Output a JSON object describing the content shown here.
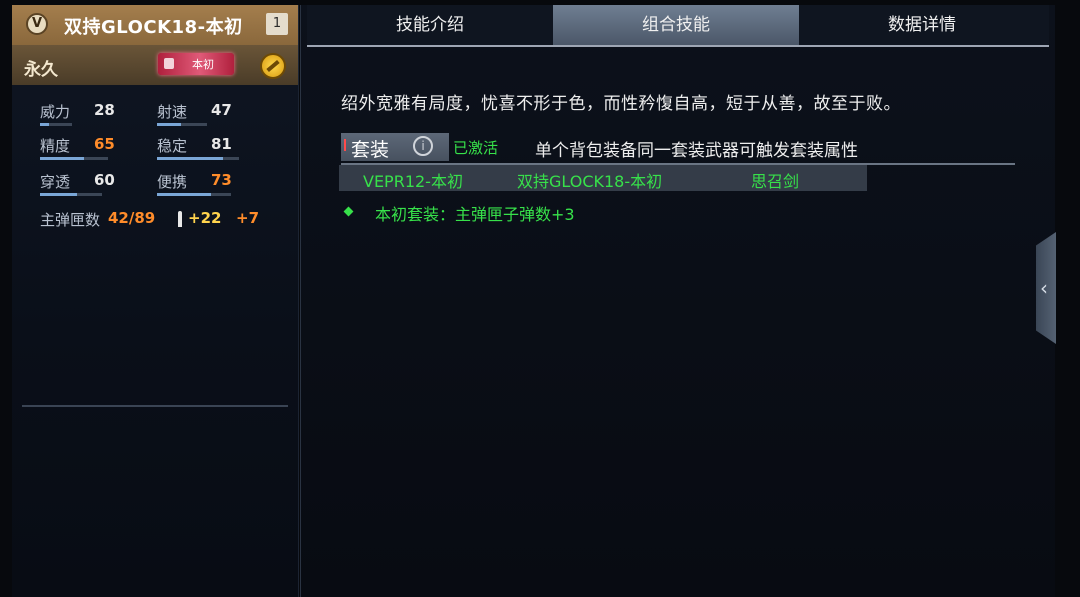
{
  "weapon": {
    "rank_badge": "V",
    "name": "双持GLOCK18-本初",
    "slot": "1",
    "duration": "永久",
    "skin_tag": "本初"
  },
  "stats": {
    "power": {
      "label": "威力",
      "value": "28",
      "level": 0.28
    },
    "fire_rate": {
      "label": "射速",
      "value": "47",
      "level": 0.47
    },
    "accuracy": {
      "label": "精度",
      "value": "65",
      "level": 0.65
    },
    "stability": {
      "label": "稳定",
      "value": "81",
      "level": 0.81
    },
    "penetration": {
      "label": "穿透",
      "value": "60",
      "level": 0.6
    },
    "mobility": {
      "label": "便携",
      "value": "73",
      "level": 0.73
    },
    "ammo": {
      "label": "主弹匣数",
      "count": "42/89",
      "bonus": "+22",
      "bonus_extra": "+7"
    }
  },
  "tabs": [
    {
      "label": "技能介绍"
    },
    {
      "label": "组合技能"
    },
    {
      "label": "数据详情"
    }
  ],
  "active_tab": 1,
  "skill": {
    "description": "绍外宽雅有局度，忧喜不形于色，而性矜愎自高，短于从善，故至于败。"
  },
  "set": {
    "label": "套装",
    "status": "已激活",
    "rule": "单个背包装备同一套装武器可触发套装属性",
    "items": [
      "VEPR12-本初",
      "双持GLOCK18-本初",
      "思召剑"
    ],
    "bonus": "本初套装：主弹匣子弹数+3"
  },
  "icons": {
    "info": "info-icon",
    "coin": "coin-icon",
    "collapse": "chevron-left-icon",
    "bullet": "bullet-icon"
  },
  "colors": {
    "accent_green": "#37e14a",
    "highlight_orange": "#ff8c2a",
    "header_gold": "#a47e4d"
  }
}
